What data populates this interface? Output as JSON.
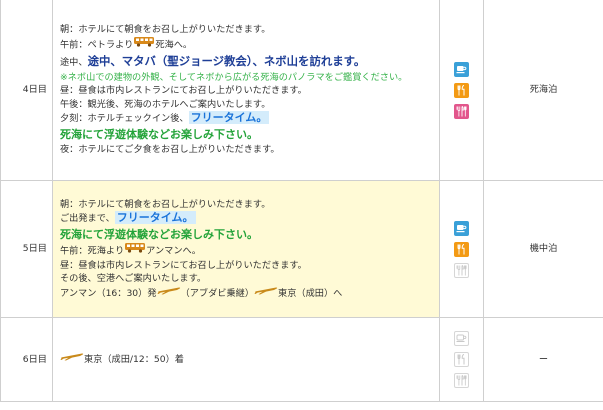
{
  "colors": {
    "breakfast": "#3aa0d8",
    "lunch": "#f39a14",
    "dinner": "#e2568c",
    "inactive": "#c9c9c9",
    "highlight_bg": "#fffad6",
    "free_time": "#1a73d9",
    "green_text": "#23a339",
    "blue_heading": "#1f3f97"
  },
  "days": [
    {
      "label": "4日目",
      "stay": "死海泊",
      "meals": {
        "breakfast": true,
        "lunch": true,
        "dinner": true
      },
      "lines": {
        "l1": "朝：ホテルにて朝食をお召し上がりいただきます。",
        "l2a": "午前：ペトラより",
        "l2b": "死海へ。",
        "l3a": "途中、",
        "l3b": "途中、マタバ（聖ジョージ教会）、ネボ山を訪れます。",
        "l4": "※ネボ山での建物の外観、そしてネボから広がる死海のパノラマをご鑑賞ください。",
        "l5": "昼：昼食は市内レストランにてお召し上がりいただきます。",
        "l6": "午後：観光後、死海のホテルへご案内いたします。",
        "l7a": "夕刻：ホテルチェックイン後、",
        "l7b": "フリータイム。",
        "l8": "死海にて浮遊体験などお楽しみ下さい。",
        "l9": "夜：ホテルにてご夕食をお召し上がりいただきます。"
      }
    },
    {
      "label": "5日目",
      "stay": "機中泊",
      "meals": {
        "breakfast": true,
        "lunch": true,
        "dinner": false
      },
      "lines": {
        "l1": "朝：ホテルにて朝食をお召し上がりいただきます。",
        "l2a": "ご出発まで、",
        "l2b": "フリータイム。",
        "l3": "死海にて浮遊体験などお楽しみ下さい。",
        "l4a": "午前：死海より",
        "l4b": "アンマンへ。",
        "l5": "昼：昼食は市内レストランにてお召し上がりいただきます。",
        "l6": "その後、空港へご案内いたします。",
        "l7a": "アンマン（16：30）発",
        "l7b": "（アブダビ乗継）",
        "l7c": "東京（成田）へ"
      }
    },
    {
      "label": "6日目",
      "stay": "ー",
      "meals": {
        "breakfast": false,
        "lunch": false,
        "dinner": false
      },
      "lines": {
        "l1": "東京（成田/12：50）着"
      }
    }
  ]
}
